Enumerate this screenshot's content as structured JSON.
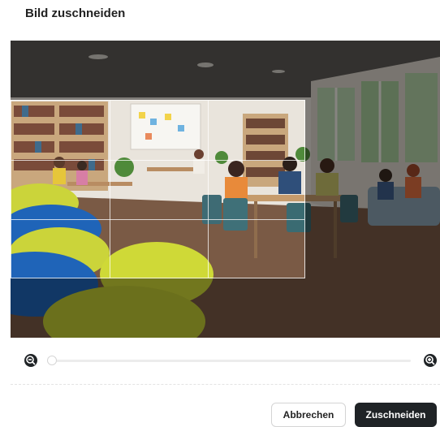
{
  "dialog": {
    "title": "Bild zuschneiden"
  },
  "image": {
    "description_icon": "library-photo"
  },
  "zoom": {
    "zoom_out_icon": "zoom-out-icon",
    "zoom_in_icon": "zoom-in-icon",
    "level_fraction": 0.0
  },
  "footer": {
    "cancel_label": "Abbrechen",
    "crop_label": "Zuschneiden"
  },
  "colors": {
    "primary_button": "#1f2326",
    "text": "#222222"
  }
}
